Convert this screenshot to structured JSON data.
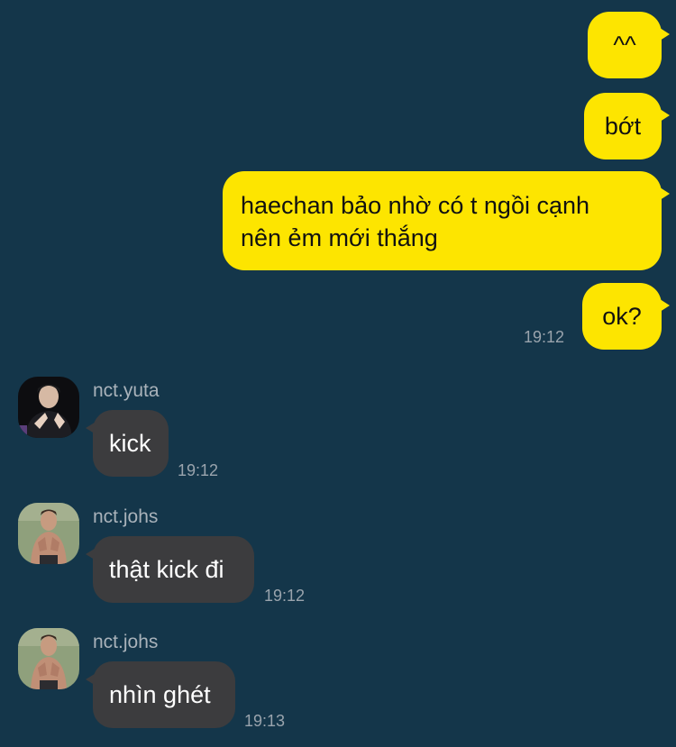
{
  "outgoing": [
    {
      "text": "^^"
    },
    {
      "text": "bớt"
    },
    {
      "line1": "haechan bảo nhờ có t ngồi cạnh",
      "line2": "nên ẻm mới thắng"
    },
    {
      "text": "ok?",
      "time": "19:12"
    }
  ],
  "incoming": [
    {
      "sender": "nct.yuta",
      "text": "kick",
      "time": "19:12",
      "avatar_icon": "user-avatar-yuta"
    },
    {
      "sender": "nct.johs",
      "text": "thật kick đi",
      "time": "19:12",
      "avatar_icon": "user-avatar-johs"
    },
    {
      "sender": "nct.johs",
      "text": "nhìn ghét",
      "time": "19:13",
      "avatar_icon": "user-avatar-johs"
    }
  ],
  "colors": {
    "background": "#14364a",
    "outgoing_bubble": "#fde500",
    "incoming_bubble": "#3c3c3e",
    "timestamp": "#9aa4ad",
    "sender_name": "#a9b2ba"
  }
}
